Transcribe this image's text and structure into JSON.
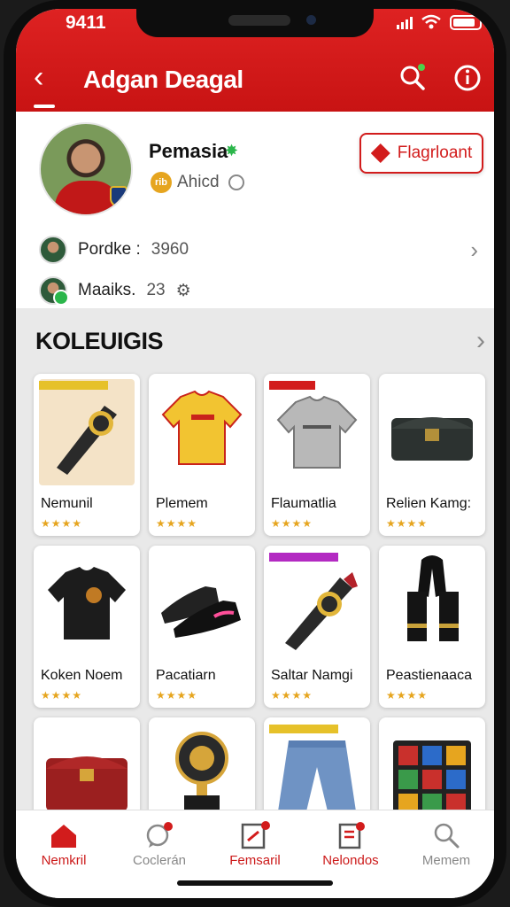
{
  "status_bar": {
    "time": "9411"
  },
  "header": {
    "title": "Adgan Deagal"
  },
  "profile": {
    "name": "Pemasia",
    "coin_text": "rib",
    "subtitle": "Ahicd",
    "action_button": "Flagrloant",
    "stats": [
      {
        "label": "Pordke :",
        "value": "3960"
      },
      {
        "label": "Maaiks.",
        "value": "23"
      }
    ]
  },
  "collection": {
    "title": "KOLEUIGIS",
    "items": [
      {
        "name": "Nemunil",
        "icon": "scarf-icon",
        "rating": "★★★★"
      },
      {
        "name": "Plemem",
        "icon": "jersey-yellow-icon",
        "rating": "★★★★"
      },
      {
        "name": "Flaumatlia",
        "icon": "jersey-grey-icon",
        "rating": "★★★★"
      },
      {
        "name": "Relien Kamg:",
        "icon": "chest-icon",
        "rating": "★★★★"
      },
      {
        "name": "Koken Noem",
        "icon": "jersey-black-icon",
        "rating": "★★★★"
      },
      {
        "name": "Pacatiarn",
        "icon": "boots-icon",
        "rating": "★★★★"
      },
      {
        "name": "Saltar Namgi",
        "icon": "scarf-icon",
        "rating": "★★★★"
      },
      {
        "name": "Peastienaaca",
        "icon": "scarf-black-icon",
        "rating": "★★★★"
      },
      {
        "name": "",
        "icon": "red-chest-icon",
        "rating": ""
      },
      {
        "name": "",
        "icon": "trophy-icon",
        "rating": ""
      },
      {
        "name": "",
        "icon": "jeans-icon",
        "rating": ""
      },
      {
        "name": "",
        "icon": "photo-grid-icon",
        "rating": ""
      }
    ]
  },
  "tabbar": {
    "tabs": [
      {
        "label": "Nemkril",
        "icon": "home-icon"
      },
      {
        "label": "Coclerán",
        "icon": "chat-icon"
      },
      {
        "label": "Femsaril",
        "icon": "edit-doc-icon"
      },
      {
        "label": "Nelondos",
        "icon": "notes-icon"
      },
      {
        "label": "Memem",
        "icon": "search-icon"
      }
    ]
  },
  "colors": {
    "brand_red": "#d21c1c",
    "star_gold": "#e6a51f"
  }
}
